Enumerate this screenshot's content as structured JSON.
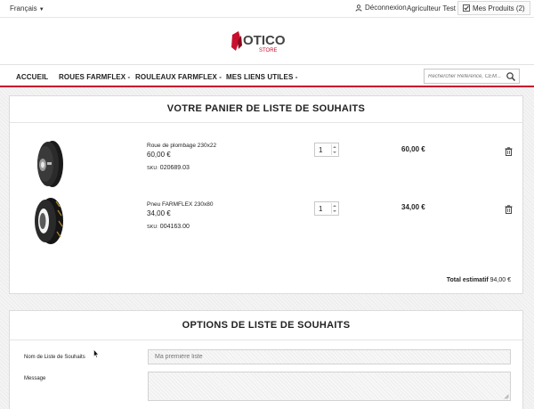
{
  "topbar": {
    "language": "Français",
    "logout": "Déconnexion",
    "user": "Agriculteur Test",
    "my_products": "Mes Produits (2)"
  },
  "logo": {
    "text": "OTICO",
    "subtext": "STORE"
  },
  "nav": {
    "items": [
      "ACCUEIL",
      "ROUES FARMFLEX -",
      "ROULEAUX FARMFLEX -",
      "MES LIENS UTILES -"
    ],
    "search_placeholder": "Rechercher Référence, CEM..."
  },
  "cart": {
    "title": "VOTRE PANIER DE LISTE DE SOUHAITS",
    "items": [
      {
        "name": "Roue de plombage 230x22",
        "price": "60,00 €",
        "sku_label": "SKU:",
        "sku": "020689.03",
        "qty": "1",
        "line_total": "60,00 €"
      },
      {
        "name": "Pneu FARMFLEX 230x80",
        "price": "34,00 €",
        "sku_label": "SKU:",
        "sku": "004163.00",
        "qty": "1",
        "line_total": "34,00 €"
      }
    ],
    "total_label": "Total estimatif",
    "total_value": "94,00 €"
  },
  "options": {
    "title": "OPTIONS DE LISTE DE SOUHAITS",
    "name_label": "Nom de Liste de Souhaits",
    "name_placeholder": "Ma première liste",
    "message_label": "Message"
  },
  "colors": {
    "accent": "#c8102e",
    "text": "#222222"
  }
}
